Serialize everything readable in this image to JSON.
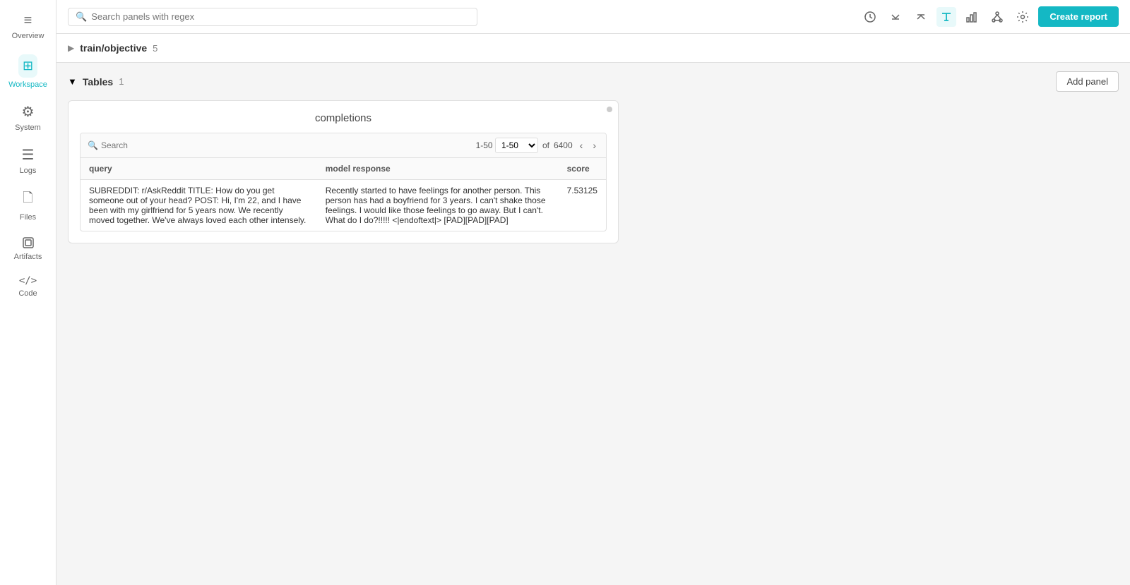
{
  "sidebar": {
    "items": [
      {
        "id": "overview",
        "label": "Overview",
        "icon": "≡",
        "active": false
      },
      {
        "id": "workspace",
        "label": "Workspace",
        "icon": "⊞",
        "active": true
      },
      {
        "id": "system",
        "label": "System",
        "icon": "⚙",
        "active": false
      },
      {
        "id": "logs",
        "label": "Logs",
        "icon": "☰",
        "active": false
      },
      {
        "id": "files",
        "label": "Files",
        "icon": "📄",
        "active": false
      },
      {
        "id": "artifacts",
        "label": "Artifacts",
        "icon": "◫",
        "active": false
      },
      {
        "id": "code",
        "label": "Code",
        "icon": "</>",
        "active": false
      }
    ]
  },
  "toolbar": {
    "search_placeholder": "Search panels with regex",
    "create_report_label": "Create report",
    "icons": [
      {
        "id": "history",
        "symbol": "⊙"
      },
      {
        "id": "collapse-down",
        "symbol": "⬇"
      },
      {
        "id": "collapse-up",
        "symbol": "⬆"
      },
      {
        "id": "text",
        "symbol": "T",
        "active": true
      },
      {
        "id": "chart",
        "symbol": "📊"
      },
      {
        "id": "nodes",
        "symbol": "⬡"
      },
      {
        "id": "settings",
        "symbol": "⚙"
      }
    ]
  },
  "section": {
    "title": "train/objective",
    "count": "5",
    "chevron_collapsed": false
  },
  "subsection": {
    "title": "Tables",
    "count": "1",
    "add_panel_label": "Add panel",
    "chevron_collapsed": false
  },
  "panel": {
    "title": "completions",
    "drag_handle": true,
    "table": {
      "search_placeholder": "Search",
      "pagination": {
        "range": "1-50",
        "total": "6400"
      },
      "columns": [
        {
          "id": "query",
          "label": "query"
        },
        {
          "id": "model_response",
          "label": "model response"
        },
        {
          "id": "score",
          "label": "score"
        }
      ],
      "rows": [
        {
          "query": "SUBREDDIT: r/AskReddit TITLE: How do you get someone out of your head? POST: Hi, I'm 22, and I have been with my girlfriend for 5 years now. We recently moved together. We've always loved each other intensely.",
          "model_response": "Recently started to have feelings for another person. This person has had a boyfriend for 3 years. I can't shake those feelings. I would like those feelings to go away. But I can't. What do I do?!!!!! <|endoftext|> [PAD][PAD][PAD]",
          "score": "7.53125"
        }
      ]
    }
  }
}
